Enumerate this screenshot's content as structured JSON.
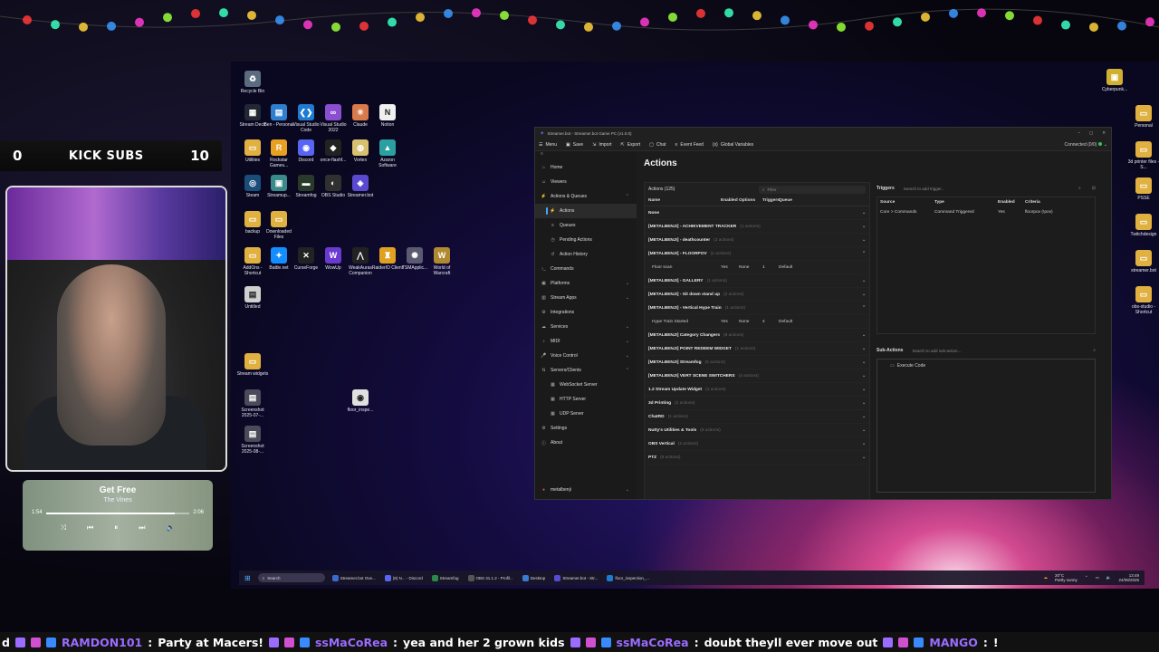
{
  "desktop": {
    "icons": [
      {
        "name": "recycle-bin",
        "label": "Recycle Bin",
        "color": "#5b6b80",
        "glyph": "♻"
      },
      {
        "name": "stream-deck",
        "label": "Stream Deck",
        "color": "#222833",
        "glyph": "▦"
      },
      {
        "name": "ben-personal",
        "label": "Ben - Personal",
        "color": "#2f7fd1",
        "glyph": "▤"
      },
      {
        "name": "visual-studio-code",
        "label": "Visual Studio Code",
        "color": "#1f7ad1",
        "glyph": "❮❯"
      },
      {
        "name": "visual-studio-2022",
        "label": "Visual Studio 2022",
        "color": "#8a4fd1",
        "glyph": "∞"
      },
      {
        "name": "claude",
        "label": "Claude",
        "color": "#d97a4a",
        "glyph": "✳"
      },
      {
        "name": "notion",
        "label": "Notion",
        "color": "#f0f0f0",
        "glyph": "N"
      },
      {
        "name": "utilities",
        "label": "Utilities",
        "color": "#e0b040",
        "glyph": "▭"
      },
      {
        "name": "rockstar-games",
        "label": "Rockstar Games...",
        "color": "#e8a020",
        "glyph": "R"
      },
      {
        "name": "discord",
        "label": "Discord",
        "color": "#5865f2",
        "glyph": "◉"
      },
      {
        "name": "once-flashf",
        "label": "once-flashf...",
        "color": "#222",
        "glyph": "◆"
      },
      {
        "name": "vortex",
        "label": "Vortex",
        "color": "#d8c070",
        "glyph": "◍"
      },
      {
        "name": "aseprite",
        "label": "Azaron Software",
        "color": "#2aa0a0",
        "glyph": "▲"
      },
      {
        "name": "steam",
        "label": "Steam",
        "color": "#1b4d7a",
        "glyph": "◎"
      },
      {
        "name": "streamup",
        "label": "Streamup...",
        "color": "#3a8a8a",
        "glyph": "▣"
      },
      {
        "name": "streamfog",
        "label": "Streamfog",
        "color": "#2a3a2a",
        "glyph": "▬"
      },
      {
        "name": "obs-studio",
        "label": "OBS Studio",
        "color": "#303030",
        "glyph": "◐"
      },
      {
        "name": "streamerbot",
        "label": "Streamer.bot",
        "color": "#5a4ad0",
        "glyph": "◈"
      },
      {
        "name": "backup",
        "label": "backup",
        "color": "#e0b040",
        "glyph": "▭"
      },
      {
        "name": "downloaded-files",
        "label": "Downloaded Files",
        "color": "#e0b040",
        "glyph": "▭"
      },
      {
        "name": "addons-shortcut",
        "label": "AddOns - Shortcut",
        "color": "#e0b040",
        "glyph": "▭"
      },
      {
        "name": "battlenet",
        "label": "Battle.net",
        "color": "#148eff",
        "glyph": "✦"
      },
      {
        "name": "curseforge",
        "label": "CurseForge",
        "color": "#222",
        "glyph": "✕"
      },
      {
        "name": "wowup",
        "label": "WowUp",
        "color": "#6a3ad0",
        "glyph": "W"
      },
      {
        "name": "weakauras",
        "label": "WeakAuras Companion",
        "color": "#222",
        "glyph": "⋀"
      },
      {
        "name": "raiderio",
        "label": "RaiderIO Client",
        "color": "#e0a020",
        "glyph": "♜"
      },
      {
        "name": "tsm",
        "label": "TSMApplic...",
        "color": "#5a5a70",
        "glyph": "✺"
      },
      {
        "name": "world-of-warcraft",
        "label": "World of Warcraft",
        "color": "#b08a30",
        "glyph": "W"
      },
      {
        "name": "untitled",
        "label": "Untitled",
        "color": "#cfcfcf",
        "glyph": "▤"
      },
      {
        "name": "stream-widgets",
        "label": "Stream widgets",
        "color": "#e0b040",
        "glyph": "▭"
      },
      {
        "name": "screenshot-1",
        "label": "Screenshot 2025-07-...",
        "color": "#4a4a5a",
        "glyph": "▤"
      },
      {
        "name": "screenshot-2",
        "label": "Screenshot 2025-08-...",
        "color": "#4a4a5a",
        "glyph": "▤"
      },
      {
        "name": "floor-image",
        "label": "floor_inspe...",
        "color": "#e0e0e0",
        "glyph": "◉"
      },
      {
        "name": "cyberpunk",
        "label": "Cyberpunk...",
        "color": "#d0b030",
        "glyph": "▣"
      },
      {
        "name": "personal",
        "label": "Personal",
        "color": "#e0b040",
        "glyph": "▭"
      },
      {
        "name": "3d-printer-files",
        "label": "3d printer files - S...",
        "color": "#e0b040",
        "glyph": "▭"
      },
      {
        "name": "psse",
        "label": "PSSE",
        "color": "#e0b040",
        "glyph": "▭"
      },
      {
        "name": "twitchdesign",
        "label": "Twitchdesign",
        "color": "#e0b040",
        "glyph": "▭"
      },
      {
        "name": "streamerbot-folder",
        "label": "streamer.bot",
        "color": "#e0b040",
        "glyph": "▭"
      },
      {
        "name": "obs-studio-shortcut",
        "label": "obs-studio - Shortcut",
        "color": "#e0b040",
        "glyph": "▭"
      }
    ]
  },
  "streamerbot": {
    "window_title": "Streamer.bot - Streamer.bot Game PC (v1.0.0)",
    "menu": [
      "Menu",
      "Save",
      "Import",
      "Export",
      "Chat",
      "Event Feed",
      "Global Variables"
    ],
    "connected": "Connected (0/0)",
    "nav": [
      {
        "label": "Home",
        "icon": "⌂",
        "level": 0
      },
      {
        "label": "Viewers",
        "icon": "☺",
        "level": 0
      },
      {
        "label": "Actions & Queues",
        "icon": "⚡",
        "level": 0,
        "chev": "⌃"
      },
      {
        "label": "Actions",
        "icon": "⚡",
        "level": 1,
        "active": true
      },
      {
        "label": "Queues",
        "icon": "≡",
        "level": 1
      },
      {
        "label": "Pending Actions",
        "icon": "◷",
        "level": 1
      },
      {
        "label": "Action History",
        "icon": "↺",
        "level": 1
      },
      {
        "label": "Commands",
        "icon": "›_",
        "level": 0
      },
      {
        "label": "Platforms",
        "icon": "▣",
        "level": 0,
        "chev": "⌄"
      },
      {
        "label": "Stream Apps",
        "icon": "▥",
        "level": 0,
        "chev": "⌄"
      },
      {
        "label": "Integrations",
        "icon": "⚙",
        "level": 0
      },
      {
        "label": "Services",
        "icon": "☁",
        "level": 0,
        "chev": "⌄"
      },
      {
        "label": "MIDI",
        "icon": "♪",
        "level": 0,
        "chev": "⌄"
      },
      {
        "label": "Voice Control",
        "icon": "🎤",
        "level": 0,
        "chev": "⌄"
      },
      {
        "label": "Servers/Clients",
        "icon": "⇅",
        "level": 0,
        "chev": "⌃"
      },
      {
        "label": "WebSocket Server",
        "icon": "▦",
        "level": 1
      },
      {
        "label": "HTTP Server",
        "icon": "▦",
        "level": 1
      },
      {
        "label": "UDP Server",
        "icon": "▦",
        "level": 1
      },
      {
        "label": "Settings",
        "icon": "⚙",
        "level": 0
      },
      {
        "label": "About",
        "icon": "ⓘ",
        "level": 0
      }
    ],
    "user": "metalbenji",
    "page_title": "Actions",
    "actions_header": "Actions (125)",
    "filter_placeholder": "Filter",
    "columns": [
      "Name",
      "Enabled",
      "Options",
      "Triggers",
      "Queue"
    ],
    "rows": [
      {
        "type": "group",
        "name": "None",
        "count": ""
      },
      {
        "type": "group",
        "name": "[METALBENJI] - ACHIEVEMENT TRACKER",
        "count": "(1 actions)"
      },
      {
        "type": "group",
        "name": "[METALBENJI] - deathcounter",
        "count": "(3 actions)"
      },
      {
        "type": "group",
        "name": "[METALBENJI] - FLOORPOV",
        "count": "(1 actions)",
        "open": true
      },
      {
        "type": "action",
        "name": "Floor scan",
        "enabled": "Yes",
        "options": "None",
        "triggers": "1",
        "queue": "Default"
      },
      {
        "type": "group",
        "name": "[METALBENJI] - GALLERY",
        "count": "(1 actions)"
      },
      {
        "type": "group",
        "name": "[METALBENJI] - Sit down stand up",
        "count": "(2 actions)"
      },
      {
        "type": "group",
        "name": "[METALBENJI] - Vertical Hype Train",
        "count": "(1 actions)",
        "open": true
      },
      {
        "type": "action",
        "name": "Hype Train Started",
        "enabled": "Yes",
        "options": "None",
        "triggers": "4",
        "queue": "Default"
      },
      {
        "type": "group",
        "name": "[METALBENJI] Category Changers",
        "count": "(8 actions)"
      },
      {
        "type": "group",
        "name": "[METALBENJI] POINT REDEEM WIDGET",
        "count": "(1 actions)"
      },
      {
        "type": "group",
        "name": "[METALBENJI] Streamfog",
        "count": "(5 actions)"
      },
      {
        "type": "group",
        "name": "[METALBENJI] VERT SCENE SWITCHERS",
        "count": "(4 actions)"
      },
      {
        "type": "group",
        "name": "1.2 Stream Update Widget",
        "count": "(1 actions)"
      },
      {
        "type": "group",
        "name": "3d Printing",
        "count": "(2 actions)"
      },
      {
        "type": "group",
        "name": "ChatRD",
        "count": "(1 actions)"
      },
      {
        "type": "group",
        "name": "Nutty's Utilities & Tools",
        "count": "(8 actions)"
      },
      {
        "type": "group",
        "name": "OBS Vertical",
        "count": "(2 actions)"
      },
      {
        "type": "group",
        "name": "PTZ",
        "count": "(8 actions)"
      }
    ],
    "triggers": {
      "title": "Triggers",
      "placeholder": "Search to add trigger...",
      "columns": [
        "Source",
        "Type",
        "Enabled",
        "Criteria"
      ],
      "rows": [
        {
          "source": "Core > Commands",
          "type": "Command Triggered",
          "enabled": "Yes",
          "criteria": "floorpov (!pov)"
        }
      ]
    },
    "subactions": {
      "title": "Sub-Actions",
      "placeholder": "Search to add sub-action...",
      "items": [
        "Execute Code"
      ]
    }
  },
  "taskbar": {
    "search": "Search",
    "apps": [
      {
        "label": "Streamer.bot Ove...",
        "color": "#3a6ad0"
      },
      {
        "label": "(8) N... - Discord",
        "color": "#5865f2"
      },
      {
        "label": "Streamfog",
        "color": "#2a8a4a"
      },
      {
        "label": "OBS 31.1.2 - Profil...",
        "color": "#555"
      },
      {
        "label": "Desktop",
        "color": "#3a7ad0"
      },
      {
        "label": "Streamer.bot - Str...",
        "color": "#5a4ad0"
      },
      {
        "label": "floor_inspection_...",
        "color": "#1f7ad1"
      }
    ],
    "weather_temp": "20°C",
    "weather_desc": "Partly sunny",
    "time": "13:49",
    "date": "24/08/2025"
  },
  "overlay": {
    "subs_left": "0",
    "subs_label": "KICK SUBS",
    "subs_right": "10",
    "music": {
      "title": "Get Free",
      "artist": "The Vines",
      "elapsed": "1:54",
      "total": "2:06",
      "progress": 0.9
    }
  },
  "ticker": {
    "segments": [
      {
        "user": "",
        "text": "d"
      },
      {
        "user": "RAMDON101",
        "text": "Party at Macers!"
      },
      {
        "user": "ssMaCoRea",
        "text": "yea and her 2 grown kids"
      },
      {
        "user": "ssMaCoRea",
        "text": "doubt theyll ever move out"
      },
      {
        "user": "MANGO",
        "text": "!"
      }
    ]
  },
  "colors": {
    "accent": "#4aa3ff",
    "connected": "#3fbf4f",
    "twitch": "#9b6cff"
  }
}
